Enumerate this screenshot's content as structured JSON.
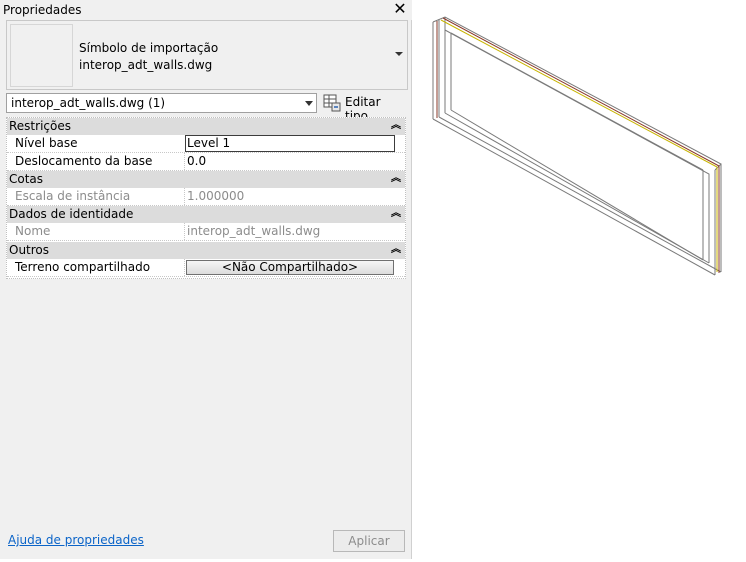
{
  "panel": {
    "title": "Propriedades",
    "close_icon": "close-icon"
  },
  "type_selector": {
    "line1": "Símbolo de importação",
    "line2": "interop_adt_walls.dwg"
  },
  "instance_selector": {
    "value": "interop_adt_walls.dwg (1)",
    "edit_type_label": "Editar tipo"
  },
  "groups": {
    "restricoes": {
      "title": "Restrições",
      "nivel_base": {
        "label": "Nível base",
        "value": "Level 1"
      },
      "deslocamento": {
        "label": "Deslocamento da base",
        "value": "0.0"
      }
    },
    "cotas": {
      "title": "Cotas",
      "escala": {
        "label": "Escala de instância",
        "value": "1.000000"
      }
    },
    "identidade": {
      "title": "Dados de identidade",
      "nome": {
        "label": "Nome",
        "value": "interop_adt_walls.dwg"
      }
    },
    "outros": {
      "title": "Outros",
      "terreno": {
        "label": "Terreno compartilhado",
        "value": "<Não Compartilhado>"
      }
    }
  },
  "footer": {
    "help_link": "Ajuda de propriedades",
    "apply_label": "Aplicar"
  },
  "colors": {
    "group_header": "#dcdcdc",
    "link": "#0b64c8",
    "wall_accent": "#8a3a2a"
  }
}
